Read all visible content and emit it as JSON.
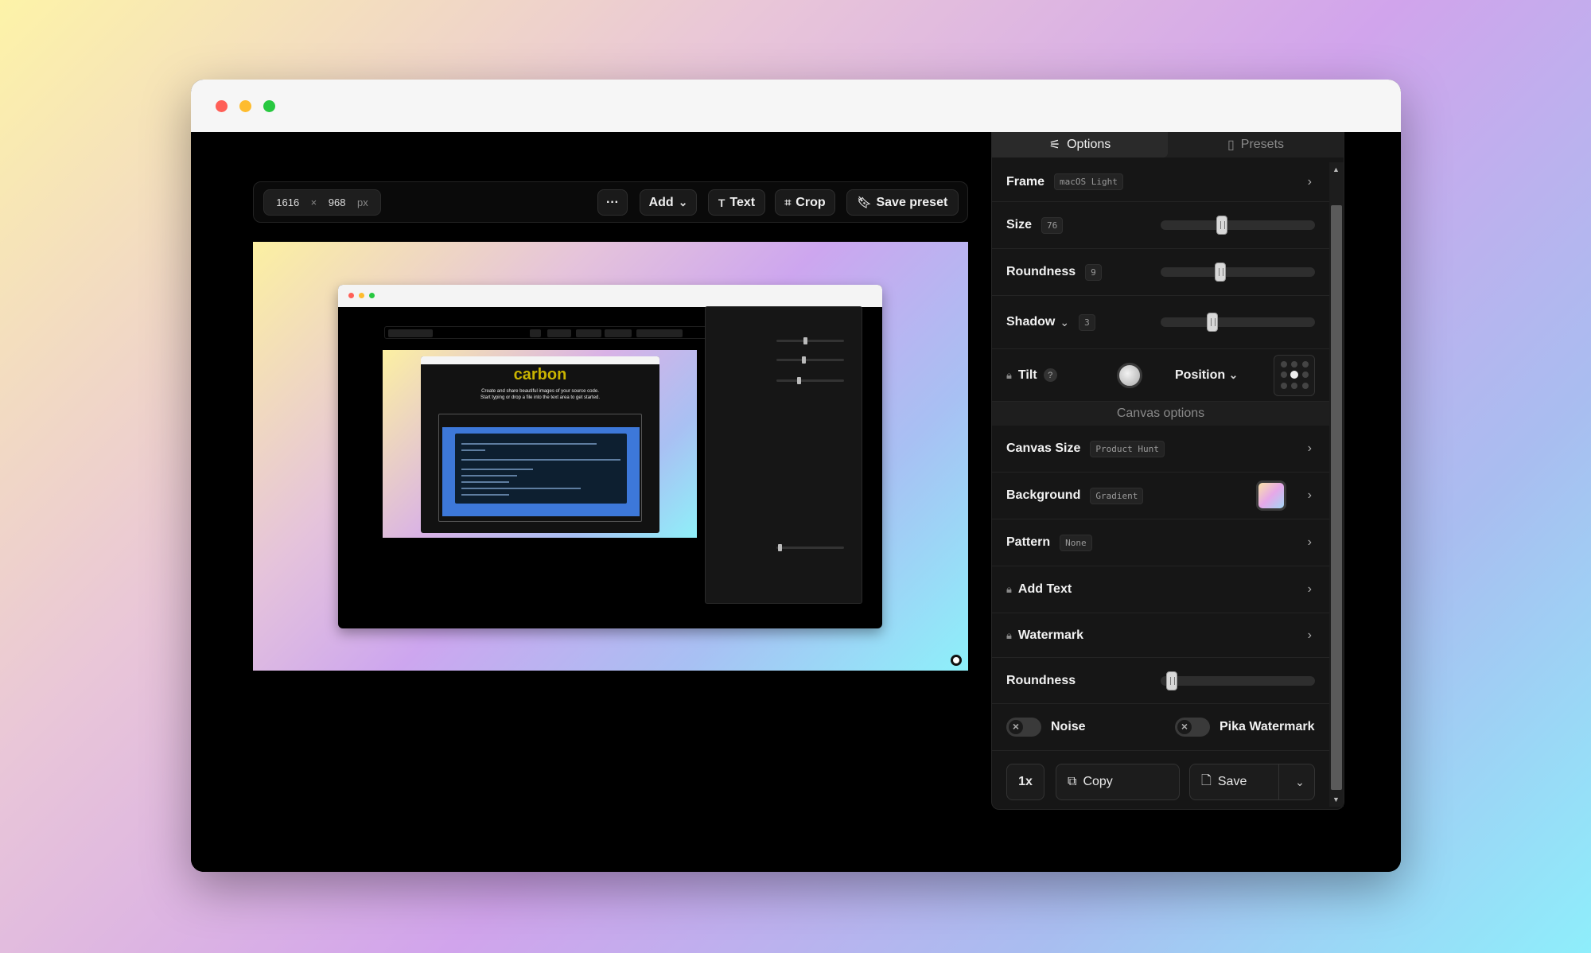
{
  "toolbar": {
    "width": "1616",
    "times": "×",
    "height": "968",
    "unit": "px",
    "more": "···",
    "add": "Add",
    "text": "Text",
    "crop": "Crop",
    "save_preset": "Save preset"
  },
  "preview": {
    "inner_logo": "carbon",
    "inner_subtitle": "Create and share beautiful images of your source code.",
    "inner_subtitle2": "Start typing or drop a file into the text area to get started."
  },
  "sidebar": {
    "tabs": [
      {
        "label": "Options",
        "icon": "sliders-icon",
        "active": true
      },
      {
        "label": "Presets",
        "icon": "bookmark-icon",
        "active": false
      }
    ],
    "frame": {
      "label": "Frame",
      "value": "macOS Light"
    },
    "size": {
      "label": "Size",
      "value": "76",
      "level": 0.39
    },
    "roundness": {
      "label": "Roundness",
      "value": "9",
      "level": 0.38
    },
    "shadow": {
      "label": "Shadow",
      "value": "3",
      "level": 0.32
    },
    "tilt": {
      "label": "Tilt",
      "help": "?"
    },
    "position": {
      "label": "Position"
    },
    "canvas_header": "Canvas options",
    "canvas_size": {
      "label": "Canvas Size",
      "value": "Product Hunt"
    },
    "background": {
      "label": "Background",
      "value": "Gradient"
    },
    "pattern": {
      "label": "Pattern",
      "value": "None"
    },
    "add_text": {
      "label": "Add Text"
    },
    "watermark": {
      "label": "Watermark"
    },
    "canvas_roundness": {
      "label": "Roundness",
      "level": 0.04
    },
    "noise": {
      "label": "Noise"
    },
    "pika_watermark": {
      "label": "Pika Watermark"
    },
    "footer": {
      "scale": "1x",
      "copy": "Copy",
      "save": "Save"
    }
  },
  "colors": {
    "window_bg": "#000000",
    "sidebar_bg": "#161616",
    "accent_red": "#ff5f57",
    "accent_yellow": "#febc2e",
    "accent_green": "#28c840"
  }
}
